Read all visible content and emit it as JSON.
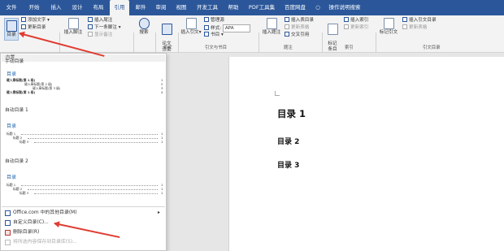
{
  "tabs": [
    {
      "label": "文件"
    },
    {
      "label": "开始"
    },
    {
      "label": "插入"
    },
    {
      "label": "设计"
    },
    {
      "label": "布局"
    },
    {
      "label": "引用",
      "active": true
    },
    {
      "label": "邮件"
    },
    {
      "label": "审阅"
    },
    {
      "label": "视图"
    },
    {
      "label": "开发工具"
    },
    {
      "label": "帮助"
    },
    {
      "label": "PDF工具集"
    },
    {
      "label": "百度网盘"
    },
    {
      "label": "操作说明搜索"
    }
  ],
  "ribbon": {
    "toc_button": "目录",
    "add_text": "添加文字",
    "update_toc": "更新目录",
    "insert_footnote": "插入脚注",
    "insert_endnote": "插入尾注",
    "next_footnote": "下一条脚注",
    "show_notes": "显示备注",
    "search": "搜索",
    "research": "论文\n查重",
    "insert_citation": "插入引文",
    "manage_sources": "管理源",
    "style_label": "样式:",
    "style_value": "APA",
    "bibliography": "书目",
    "insert_caption": "插入题注",
    "insert_table_of_figures": "插入表目录",
    "update_table": "更新表格",
    "cross_reference": "交叉引用",
    "mark_entry": "标记\n条目",
    "insert_index": "插入索引",
    "update_index": "更新索引",
    "mark_citation": "标记引文",
    "insert_toa": "插入引文目录",
    "update_toa": "更新表格",
    "group_paper": "论文",
    "group_citations": "引文与书目",
    "group_captions": "题注",
    "group_index": "索引",
    "group_toa": "引文目录"
  },
  "menu": {
    "section_builtin": "内置",
    "manual_title": "手动目录",
    "preview1": {
      "heading": "目录",
      "lines": [
        "键入章标题(第 1 级)",
        "键入章标题(第 2 级)",
        "键入章标题(第 3 级)",
        "键入章标题(第 1 级)"
      ],
      "pages": [
        "1",
        "2",
        "3",
        "4"
      ]
    },
    "auto1_title": "自动目录 1",
    "preview2": {
      "heading": "目录",
      "lines": [
        "标题 1",
        "标题 2",
        "标题 3"
      ],
      "pages": [
        "1",
        "1",
        "1"
      ]
    },
    "auto2_title": "自动目录 2",
    "preview3": {
      "heading": "目录",
      "lines": [
        "标题 1",
        "标题 2",
        "标题 3"
      ],
      "pages": [
        "1",
        "1",
        "1"
      ]
    },
    "office_more": "Office.com 中的其他目录(M)",
    "custom_toc": "自定义目录(C)...",
    "remove_toc": "删除目录(R)",
    "save_selection": "将所选内容保存到目录库(S)..."
  },
  "document": {
    "h1": "目录 1",
    "h2": "目录 2",
    "h3": "目录 3"
  },
  "colors": {
    "accent": "#2b579a",
    "arrow": "#e03c31"
  }
}
